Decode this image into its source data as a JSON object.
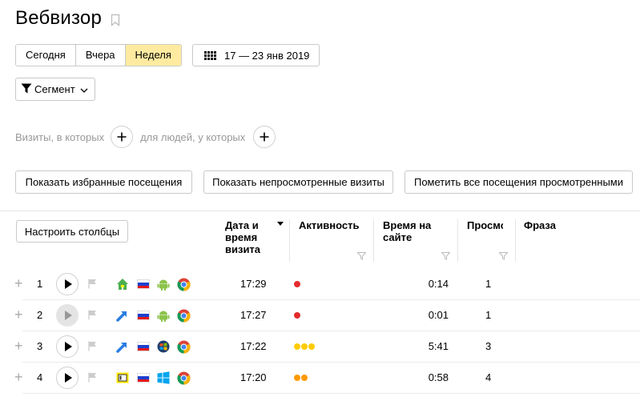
{
  "title": "Вебвизор",
  "periods": [
    {
      "label": "Сегодня",
      "active": false
    },
    {
      "label": "Вчера",
      "active": false
    },
    {
      "label": "Неделя",
      "active": true
    }
  ],
  "date_range": "17 — 23 янв 2019",
  "segment_label": "Сегмент",
  "filters": {
    "visits_label": "Визиты, в которых",
    "people_label": "для людей, у которых"
  },
  "actions": {
    "favorites": "Показать избранные посещения",
    "unviewed": "Показать непросмотренные визиты",
    "mark_all": "Пометить все посещения просмотренными"
  },
  "configure_columns": "Настроить столбцы",
  "columns": {
    "datetime": "Дата и время визита",
    "activity": "Активность",
    "time_on_site": "Время на сайте",
    "views": "Просмотры",
    "phrase": "Фраза"
  },
  "colors": {
    "active_period": "#ffeba0",
    "activity_red": "#e52b2b",
    "activity_yellow": "#ffcc00",
    "activity_orange": "#ff9900"
  },
  "rows": [
    {
      "num": "1",
      "source_icon": "home-icon",
      "country": "russia-flag",
      "os_icon": "android-icon",
      "browser_icon": "chrome-icon",
      "time": "17:29",
      "activity": [
        "#e52b2b"
      ],
      "duration": "0:14",
      "views": "1",
      "played": false
    },
    {
      "num": "2",
      "source_icon": "link-arrow-icon",
      "country": "russia-flag",
      "os_icon": "android-icon",
      "browser_icon": "chrome-icon",
      "time": "17:27",
      "activity": [
        "#e52b2b"
      ],
      "duration": "0:01",
      "views": "1",
      "played": true
    },
    {
      "num": "3",
      "source_icon": "link-arrow-icon",
      "country": "russia-flag",
      "os_icon": "windows-7-icon",
      "browser_icon": "chrome-icon",
      "time": "17:22",
      "activity": [
        "#ffcc00",
        "#ffcc00",
        "#ffcc00"
      ],
      "duration": "5:41",
      "views": "3",
      "played": false
    },
    {
      "num": "4",
      "source_icon": "direct-ad-icon",
      "country": "russia-flag",
      "os_icon": "windows-icon",
      "browser_icon": "chrome-icon",
      "time": "17:20",
      "activity": [
        "#ff9900",
        "#ff9900"
      ],
      "duration": "0:58",
      "views": "4",
      "played": false
    }
  ]
}
